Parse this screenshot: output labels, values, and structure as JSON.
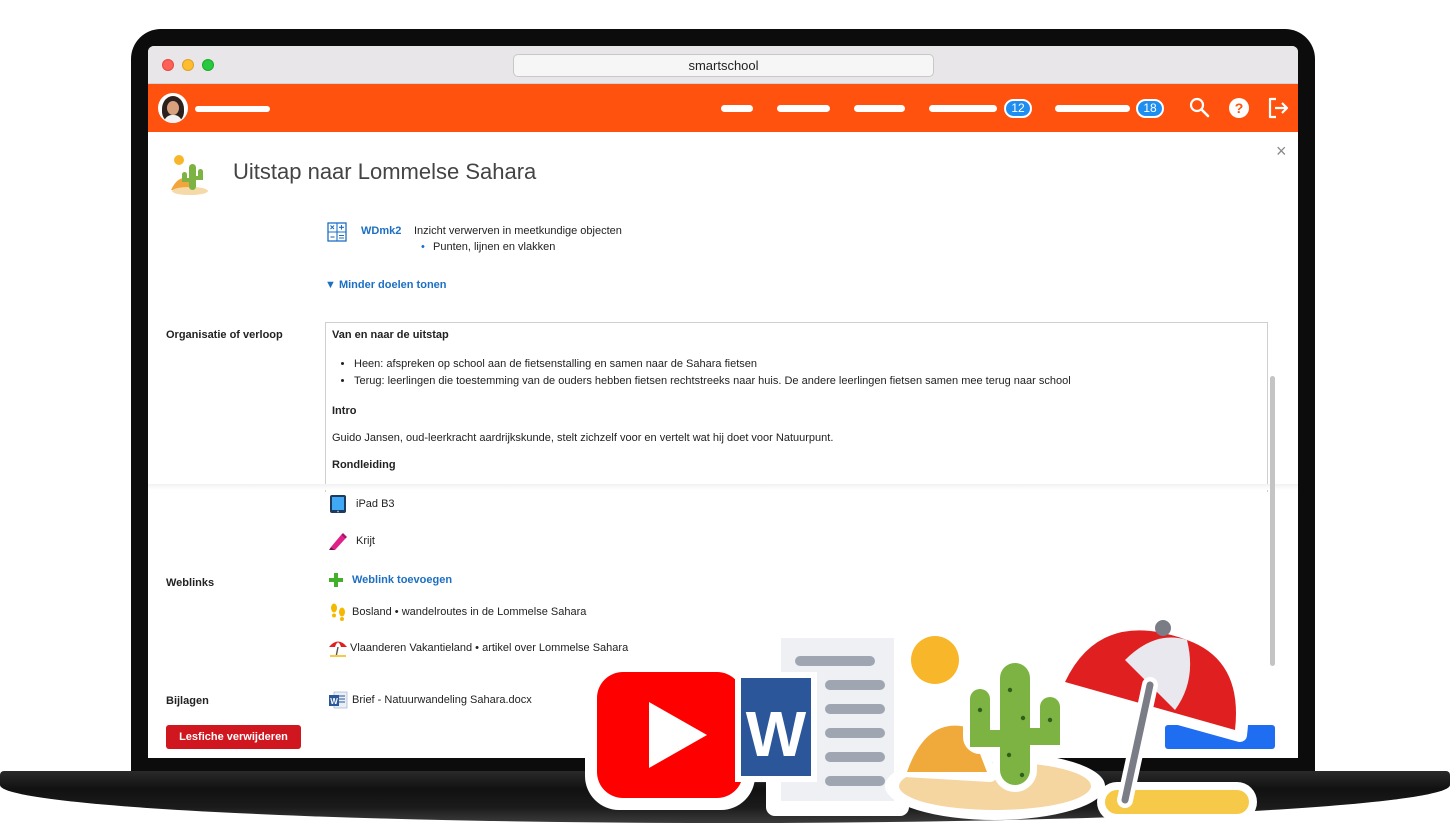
{
  "browser": {
    "url": "smartschool"
  },
  "nav": {
    "badges": [
      "12",
      "18"
    ]
  },
  "lesson": {
    "title": "Uitstap naar Lommelse Sahara"
  },
  "goal": {
    "code": "WDmk2",
    "text": "Inzicht verwerven in meetkundige objecten",
    "sub": "Punten, lijnen en vlakken",
    "toggle": "▼ Minder doelen tonen"
  },
  "organisation": {
    "label": "Organisatie of verloop",
    "heading1": "Van en naar de uitstap",
    "bullets": [
      "Heen: afspreken op school aan de fietsenstalling en samen naar de Sahara fietsen",
      "Terug: leerlingen die toestemming van de ouders hebben fietsen rechtstreeks naar huis. De andere leerlingen fietsen samen mee terug naar school"
    ],
    "heading2": "Intro",
    "intro": "Guido Jansen, oud-leerkracht aardrijkskunde, stelt zichzelf voor en vertelt wat hij doet voor Natuurpunt.",
    "heading3": "Rondleiding"
  },
  "materials": [
    "iPad B3",
    "Krijt"
  ],
  "weblinks": {
    "label": "Weblinks",
    "add": "Weblink toevoegen",
    "items": [
      "Bosland • wandelroutes in de Lommelse Sahara",
      "Vlaanderen Vakantieland • artikel over Lommelse Sahara"
    ]
  },
  "attachments": {
    "label": "Bijlagen",
    "items": [
      "Brief - Natuurwandeling Sahara.docx"
    ]
  },
  "actions": {
    "delete": "Lesfiche verwijderen"
  },
  "colors": {
    "brand": "#ff520e",
    "link": "#1c6fc3",
    "danger": "#d0171f",
    "badge": "#1f8ef1"
  },
  "icons": [
    "search-icon",
    "help-icon",
    "logout-icon",
    "close-icon",
    "cactus-icon",
    "calculator-icon",
    "ipad-icon",
    "chalk-icon",
    "plus-icon",
    "footprints-icon",
    "parasol-icon",
    "word-icon",
    "youtube-icon"
  ]
}
